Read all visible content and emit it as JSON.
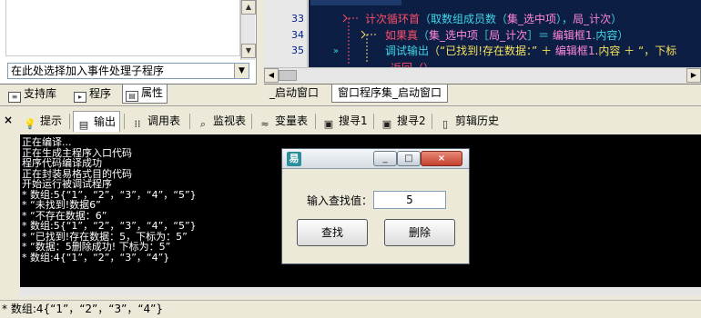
{
  "left_panel": {
    "event_selector_text": "在此处选择加入事件处理子程序",
    "tabs": [
      {
        "label": "支持库",
        "icon": "library-icon"
      },
      {
        "label": "程序",
        "icon": "program-icon"
      },
      {
        "label": "属性",
        "icon": "properties-icon",
        "active": true
      }
    ]
  },
  "editor": {
    "line_numbers": [
      "33",
      "34",
      "35"
    ],
    "code_lines": [
      {
        "prefix": "",
        "parts": [
          {
            "text": "计次循环首",
            "color": "red"
          },
          {
            "text": "（取数组成员数（",
            "color": "cyan"
          },
          {
            "text": "集_选中项",
            "color": "pink"
          },
          {
            "text": "），",
            "color": "cyan"
          },
          {
            "text": "局_计次",
            "color": "pink"
          },
          {
            "text": "）",
            "color": "cyan"
          }
        ]
      },
      {
        "prefix": "",
        "parts": [
          {
            "text": "如果真",
            "color": "red"
          },
          {
            "text": "（",
            "color": "cyan"
          },
          {
            "text": "集_选中项",
            "color": "pink"
          },
          {
            "text": "［",
            "color": "cyan"
          },
          {
            "text": "局_计次",
            "color": "pink"
          },
          {
            "text": "］＝ ",
            "color": "cyan"
          },
          {
            "text": "编辑框1",
            "color": "pink"
          },
          {
            "text": ".内容",
            "color": "cyan"
          },
          {
            "text": "）",
            "color": "cyan"
          }
        ]
      },
      {
        "prefix": "",
        "parts": [
          {
            "text": "调试输出",
            "color": "cyan"
          },
          {
            "text": "（“已找到!存在数据：” ＋ ",
            "color": "yellow"
          },
          {
            "text": "编辑框1",
            "color": "pink"
          },
          {
            "text": ".内容 ＋ “，下标",
            "color": "yellow"
          }
        ]
      }
    ],
    "partial_line": "返回（）",
    "tabs": [
      {
        "label": "_启动窗口",
        "active": false
      },
      {
        "label": "窗口程序集_启动窗口",
        "active": true
      }
    ]
  },
  "output_panel": {
    "tabs": [
      {
        "label": "提示",
        "icon": "hint-icon"
      },
      {
        "label": "输出",
        "icon": "output-icon",
        "active": true
      },
      {
        "label": "调用表",
        "icon": "call-table-icon"
      },
      {
        "label": "监视表",
        "icon": "watch-icon"
      },
      {
        "label": "变量表",
        "icon": "variable-icon"
      },
      {
        "label": "搜寻1",
        "icon": "search1-icon"
      },
      {
        "label": "搜寻2",
        "icon": "search2-icon"
      },
      {
        "label": "剪辑历史",
        "icon": "clip-history-icon"
      }
    ],
    "lines": [
      "正在编译...",
      "正在生成主程序入口代码",
      "程序代码编译成功",
      "正在封装易格式目的代码",
      "开始运行被调试程序",
      "* 数组:5{“1”，“2”，“3”，“4”，“5”}",
      "* “未找到!数据6”",
      "* “不存在数据：6”",
      "* 数组:5{“1”，“2”，“3”，“4”，“5”}",
      "* “已找到!存在数据：5，下标为：5”",
      "* “数据：5删除成功! 下标为：5”",
      "* 数组:4{“1”，“2”，“3”，“4”}"
    ]
  },
  "status_bar": {
    "text": "* 数组:4{“1”，“2”，“3”，“4”}"
  },
  "dialog": {
    "input_label": "输入查找值：",
    "input_value": "5",
    "find_button": "查找",
    "delete_button": "删除",
    "title_buttons": [
      "minimize",
      "maximize",
      "close"
    ]
  },
  "colors": {
    "code_background": "#0d1e44",
    "output_background": "#000000",
    "window_background": "#ece9d8"
  }
}
